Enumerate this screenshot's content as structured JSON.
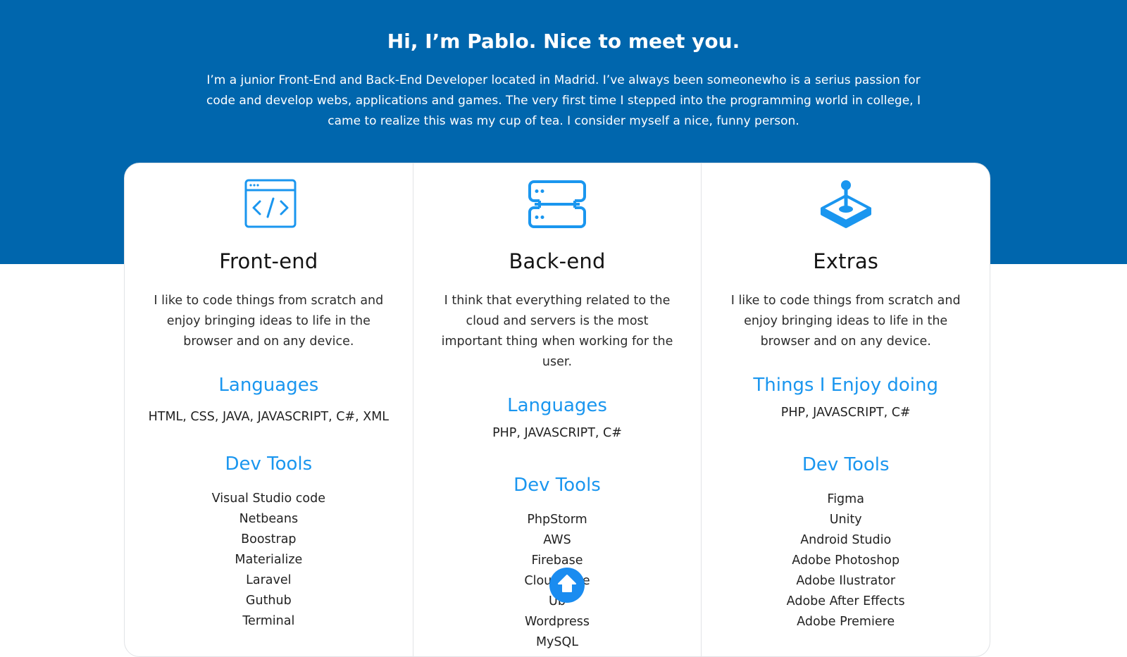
{
  "hero": {
    "title": "Hi, I’m Pablo. Nice to meet you.",
    "intro": "I’m a junior Front-End and Back-End Developer located in Madrid. I’ve always been someonewho is a serius passion for code and develop webs, applications and games. The very first time I stepped into the programming world in college, I came to realize this was my cup of tea. I consider myself a nice, funny person."
  },
  "colors": {
    "hero_bg": "#0066ad",
    "accent": "#1a96ef",
    "scroll_button": "#1a8cf0"
  },
  "columns": [
    {
      "icon": "code-window-icon",
      "title": "Front-end",
      "description": "I like to code things from scratch and enjoy bringing ideas to life in the browser and on any device.",
      "lang_heading": "Languages",
      "lang_text": "HTML, CSS, JAVA, JAVASCRIPT, C#, XML",
      "tools_heading": "Dev Tools",
      "tools": [
        "Visual Studio code",
        "Netbeans",
        "Boostrap",
        "Materialize",
        "Laravel",
        "Guthub",
        "Terminal"
      ]
    },
    {
      "icon": "server-icon",
      "title": "Back-end",
      "description": "I think that everything related to the cloud and servers is the most important thing when working for the user.",
      "lang_heading": "Languages",
      "lang_text": "PHP, JAVASCRIPT, C#",
      "tools_heading": "Dev Tools",
      "tools": [
        "PhpStorm",
        "AWS",
        "Firebase",
        "CloudFlare",
        "Ub",
        "Wordpress",
        "MySQL"
      ]
    },
    {
      "icon": "joystick-icon",
      "title": "Extras",
      "description": "I like to code things from scratch and enjoy bringing ideas to life in the browser and on any device.",
      "lang_heading": "Things I Enjoy doing",
      "lang_text": "PHP, JAVASCRIPT, C#",
      "tools_heading": "Dev Tools",
      "tools": [
        "Figma",
        "Unity",
        "Android Studio",
        "Adobe Photoshop",
        "Adobe Ilustrator",
        "Adobe After Effects",
        "Adobe Premiere"
      ]
    }
  ],
  "scroll_top": {
    "icon": "arrow-up-icon"
  }
}
